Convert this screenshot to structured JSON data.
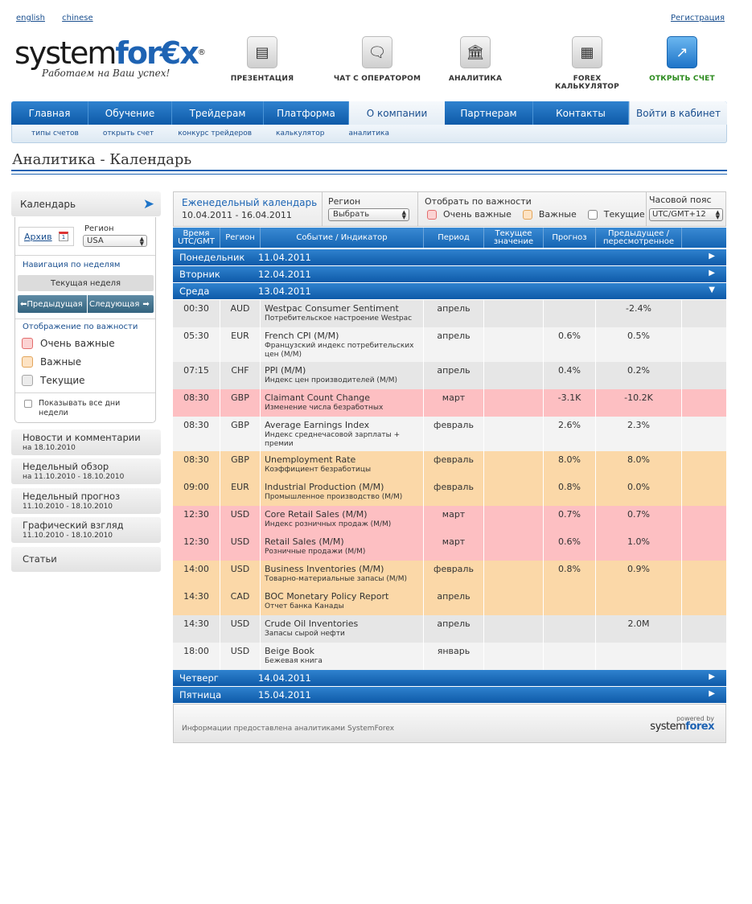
{
  "top": {
    "lang_en": "english",
    "lang_cn": "chinese",
    "register": "Регистрация"
  },
  "logo": {
    "word_a": "system",
    "word_b": "for€x",
    "reg": "®",
    "slogan": "Работаем на Ваш успех!"
  },
  "header_icons": [
    {
      "label": "ПРЕЗЕНТАЦИЯ",
      "icon": "tv-icon"
    },
    {
      "label": "ЧАТ С ОПЕРАТОРОМ",
      "icon": "chat-icon"
    },
    {
      "label": "АНАЛИТИКА",
      "icon": "building-icon"
    },
    {
      "label": "FOREX КАЛЬКУЛЯТОР",
      "icon": "calculator-icon"
    },
    {
      "label": "ОТКРЫТЬ СЧЕТ",
      "icon": "chart-up-icon"
    }
  ],
  "nav": [
    "Главная",
    "Обучение",
    "Трейдерам",
    "Платформа",
    "О компании",
    "Партнерам",
    "Контакты",
    "Войти в кабинет"
  ],
  "subnav": [
    "типы счетов",
    "открыть счет",
    "конкурс трейдеров",
    "калькулятор",
    "аналитика"
  ],
  "page_title": "Аналитика - Календарь",
  "sidebar": {
    "head": "Календарь",
    "archive": "Архив",
    "cal_day": "1",
    "region_label": "Регион",
    "region_value": "USA",
    "nav_label": "Навигация по неделям",
    "current_week": "Текущая неделя",
    "prev": "Предыдущая",
    "next": "Следующая",
    "importance_label": "Отображение по важности",
    "imp_very": "Очень важные",
    "imp_imp": "Важные",
    "imp_cur": "Текущие",
    "show_all": "Показывать все дни недели",
    "items": [
      {
        "title": "Новости и комментарии",
        "date": "на 18.10.2010"
      },
      {
        "title": "Недельный обзор",
        "date": "на 11.10.2010 - 18.10.2010"
      },
      {
        "title": "Недельный прогноз",
        "date": "11.10.2010 - 18.10.2010"
      },
      {
        "title": "Графический взгляд",
        "date": "11.10.2010 - 18.10.2010"
      },
      {
        "title": "Статьи",
        "date": ""
      }
    ]
  },
  "calendar": {
    "title": "Еженедельный календарь",
    "dates": "10.04.2011 - 16.04.2011",
    "region_label": "Регион",
    "region_value": "Выбрать",
    "importance_label": "Отобрать по важности",
    "imp_very": "Очень важные",
    "imp_imp": "Важные",
    "imp_cur": "Текущие",
    "tz_label": "Часовой пояс",
    "tz_value": "UTC/GMT+12",
    "headers": {
      "time": "Время UTC/GMT",
      "region": "Регион",
      "event": "Событие / Индикатор",
      "period": "Период",
      "current": "Текущее значение",
      "forecast": "Прогноз",
      "previous": "Предыдущее / пересмотренное"
    },
    "days": [
      {
        "name": "Понедельник",
        "date": "11.04.2011"
      },
      {
        "name": "Вторник",
        "date": "12.04.2011"
      },
      {
        "name": "Среда",
        "date": "13.04.2011"
      },
      {
        "name": "Четверг",
        "date": "14.04.2011"
      },
      {
        "name": "Пятница",
        "date": "15.04.2011"
      }
    ],
    "events": [
      {
        "time": "00:30",
        "region": "AUD",
        "en": "Westpac Consumer Sentiment",
        "ru": "Потребительское настроение Westpac",
        "period": "апрель",
        "current": "",
        "forecast": "",
        "previous": "-2.4%",
        "importance": "current"
      },
      {
        "time": "05:30",
        "region": "EUR",
        "en": "French CPI (M/M)",
        "ru": "Французский индекс потребительских цен (M/M)",
        "period": "апрель",
        "current": "",
        "forecast": "0.6%",
        "previous": "0.5%",
        "importance": "current"
      },
      {
        "time": "07:15",
        "region": "CHF",
        "en": "PPI (M/M)",
        "ru": "Индекс цен производителей (M/M)",
        "period": "апрель",
        "current": "",
        "forecast": "0.4%",
        "previous": "0.2%",
        "importance": "current"
      },
      {
        "time": "08:30",
        "region": "GBP",
        "en": "Claimant Count Change",
        "ru": "Изменение числа безработных",
        "period": "март",
        "current": "",
        "forecast": "-3.1K",
        "previous": "-10.2K",
        "importance": "very"
      },
      {
        "time": "08:30",
        "region": "GBP",
        "en": "Average Earnings Index",
        "ru": "Индекс среднечасовой зарплаты + премии",
        "period": "февраль",
        "current": "",
        "forecast": "2.6%",
        "previous": "2.3%",
        "importance": "current"
      },
      {
        "time": "08:30",
        "region": "GBP",
        "en": "Unemployment Rate",
        "ru": "Коэффициент безработицы",
        "period": "февраль",
        "current": "",
        "forecast": "8.0%",
        "previous": "8.0%",
        "importance": "important"
      },
      {
        "time": "09:00",
        "region": "EUR",
        "en": "Industrial Production (M/M)",
        "ru": "Промышленное производство (M/M)",
        "period": "февраль",
        "current": "",
        "forecast": "0.8%",
        "previous": "0.0%",
        "importance": "important"
      },
      {
        "time": "12:30",
        "region": "USD",
        "en": "Core Retail Sales (M/M)",
        "ru": "Индекс розничных продаж (M/M)",
        "period": "март",
        "current": "",
        "forecast": "0.7%",
        "previous": "0.7%",
        "importance": "very"
      },
      {
        "time": "12:30",
        "region": "USD",
        "en": "Retail Sales (M/M)",
        "ru": "Розничные продажи (M/M)",
        "period": "март",
        "current": "",
        "forecast": "0.6%",
        "previous": "1.0%",
        "importance": "very"
      },
      {
        "time": "14:00",
        "region": "USD",
        "en": "Business Inventories (M/M)",
        "ru": "Товарно-материальные запасы (M/M)",
        "period": "февраль",
        "current": "",
        "forecast": "0.8%",
        "previous": "0.9%",
        "importance": "important"
      },
      {
        "time": "14:30",
        "region": "CAD",
        "en": "BOC Monetary Policy Report",
        "ru": "Отчет банка Канады",
        "period": "апрель",
        "current": "",
        "forecast": "",
        "previous": "",
        "importance": "important"
      },
      {
        "time": "14:30",
        "region": "USD",
        "en": "Crude Oil Inventories",
        "ru": "Запасы сырой нефти",
        "period": "апрель",
        "current": "",
        "forecast": "",
        "previous": "2.0M",
        "importance": "current"
      },
      {
        "time": "18:00",
        "region": "USD",
        "en": "Beige Book",
        "ru": "Бежевая книга",
        "period": "январь",
        "current": "",
        "forecast": "",
        "previous": "",
        "importance": "current"
      }
    ],
    "footer_info": "Информации предоставлена аналитиками SystemForex",
    "powered": "powered by",
    "powered_logo_a": "system",
    "powered_logo_b": "forex"
  },
  "colors": {
    "accent": "#1e63b3",
    "very_important": "#fdbfc2",
    "important": "#fbd8a8",
    "current": "#e6e6e6"
  }
}
